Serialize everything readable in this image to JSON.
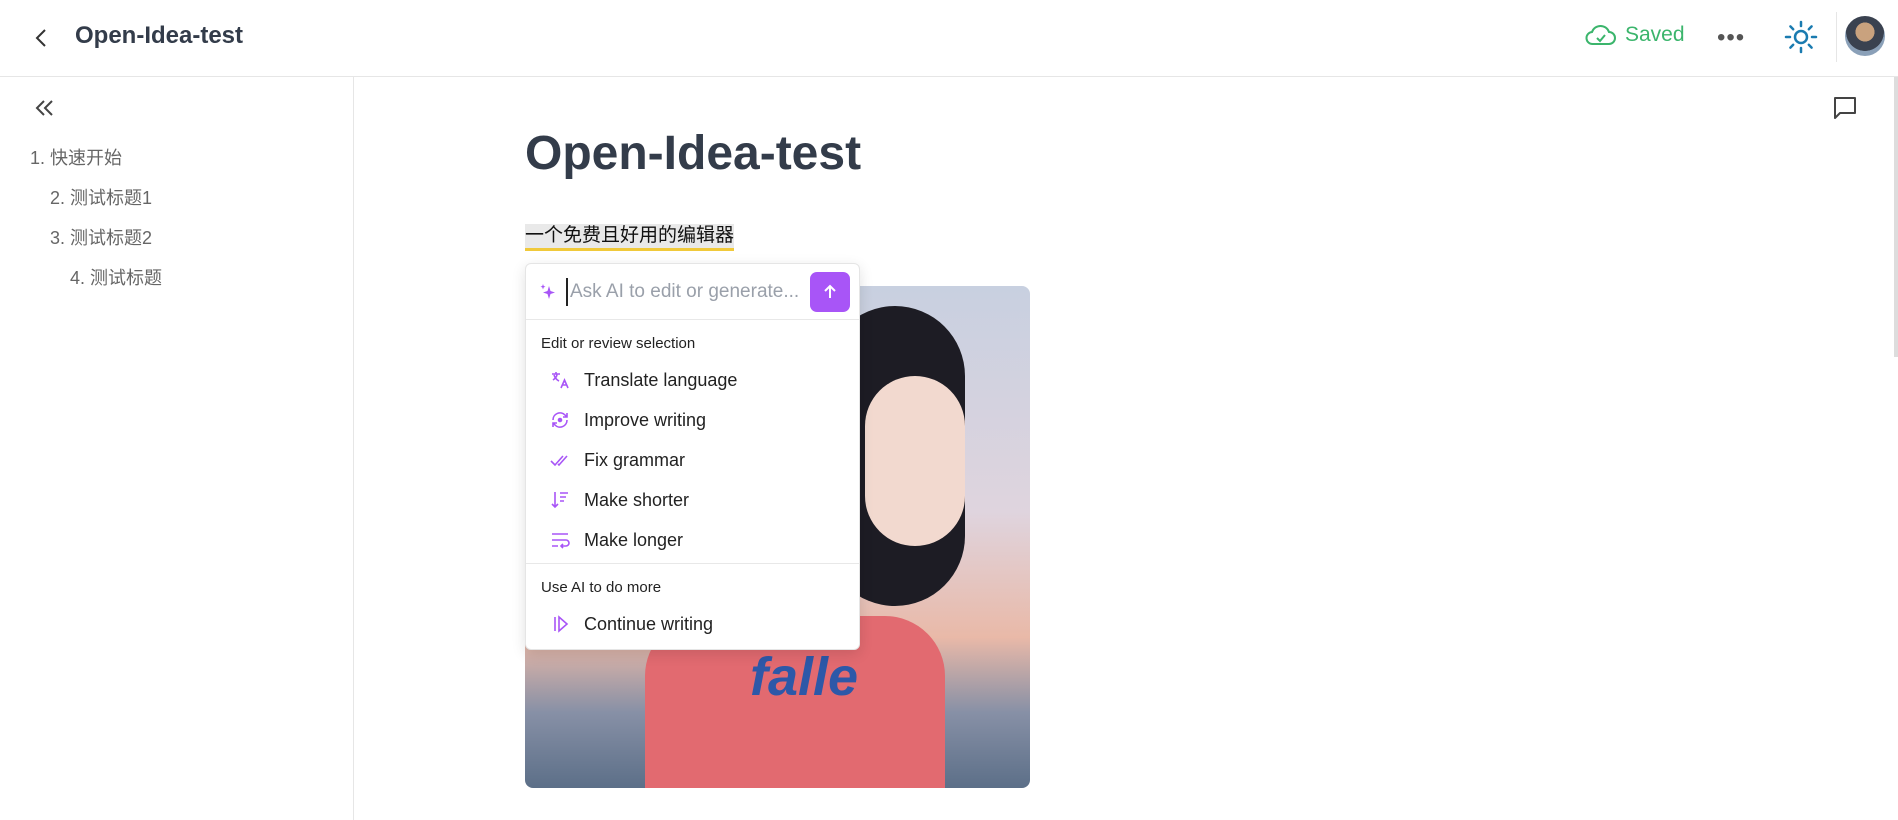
{
  "header": {
    "title": "Open-Idea-test",
    "status": "Saved",
    "status_color": "#3bb56c",
    "more_icon": "more-horizontal-icon",
    "theme_icon": "sun-icon"
  },
  "sidebar": {
    "toc": [
      {
        "label": "1. 快速开始"
      },
      {
        "label": "2. 测试标题1"
      },
      {
        "label": "3. 测试标题2"
      },
      {
        "label": "4. 测试标题"
      }
    ]
  },
  "document": {
    "title": "Open-Idea-test",
    "paragraph": "一个免费且好用的编辑器"
  },
  "ai_menu": {
    "placeholder": "Ask AI to edit or generate...",
    "accent": "#a855f7",
    "section1": "Edit or review selection",
    "items": [
      {
        "label": "Translate language",
        "icon": "translate-icon"
      },
      {
        "label": "Improve writing",
        "icon": "refresh-icon"
      },
      {
        "label": "Fix grammar",
        "icon": "check-check-icon"
      },
      {
        "label": "Make shorter",
        "icon": "sort-down-icon"
      },
      {
        "label": "Make longer",
        "icon": "wrap-text-icon"
      }
    ],
    "section2": "Use AI to do more",
    "more_items": [
      {
        "label": "Continue writing",
        "icon": "play-icon"
      }
    ]
  }
}
